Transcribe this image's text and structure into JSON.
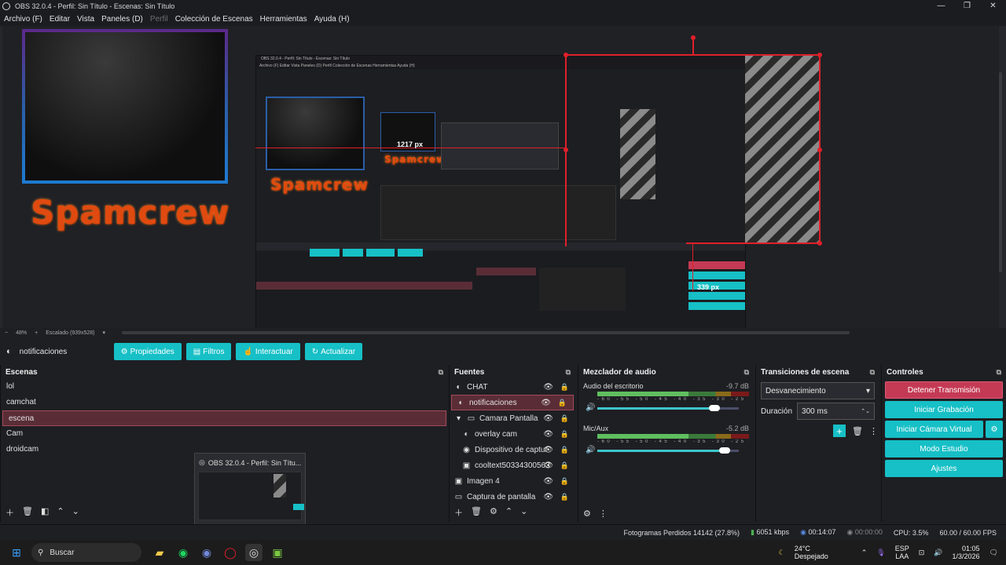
{
  "window": {
    "title": "OBS 32.0.4 - Perfil: Sin Título - Escenas: Sin Título",
    "min": "—",
    "max": "❐",
    "close": "✕"
  },
  "menu": [
    "Archivo (F)",
    "Editar",
    "Vista",
    "Paneles (D)",
    "Perfil",
    "Colección de Escenas",
    "Herramientas",
    "Ayuda (H)"
  ],
  "preview": {
    "spam_text": "Spamcrew",
    "measure_h": "1217 px",
    "measure_v": "339 px",
    "nested_title": "OBS 32.0.4 - Perfil: Sin Título - Escenas: Sin Título",
    "nested_menu": "Archivo (F)   Editar   Vista   Paneles (D)   Perfil   Colección de Escenas   Herramientas   Ayuda (H)",
    "zoom": "48%",
    "scaled": "Escalado (939x528)"
  },
  "source_bar": {
    "name": "notificaciones",
    "buttons": [
      "Propiedades",
      "Filtros",
      "Interactuar",
      "Actualizar"
    ]
  },
  "scenes": {
    "title": "Escenas",
    "items": [
      "lol",
      "camchat",
      "escena",
      "Cam",
      "droidcam"
    ],
    "selected": 2
  },
  "sources": {
    "title": "Fuentes",
    "items": [
      {
        "label": "CHAT",
        "icon": "◐",
        "indent": 0
      },
      {
        "label": "notificaciones",
        "icon": "◐",
        "indent": 0,
        "sel": true
      },
      {
        "label": "Camara Pantalla",
        "icon": "▭",
        "indent": 0,
        "group": true
      },
      {
        "label": "overlay cam",
        "icon": "◐",
        "indent": 1
      },
      {
        "label": "Dispositivo de captur",
        "icon": "◉",
        "indent": 1
      },
      {
        "label": "cooltext50334300563",
        "icon": "▣",
        "indent": 1
      },
      {
        "label": "Imagen 4",
        "icon": "▣",
        "indent": 0
      },
      {
        "label": "Captura de pantalla",
        "icon": "▭",
        "indent": 0
      }
    ]
  },
  "mixer": {
    "title": "Mezclador de audio",
    "channels": [
      {
        "name": "Audio del escritorio",
        "db": "-9.7 dB",
        "level": 0.83
      },
      {
        "name": "Mic/Aux",
        "db": "-5.2 dB",
        "level": 0.9
      }
    ],
    "scale": "-60 -55 -50 -45 -40 -35 -30 -25 -20 -15 -10 -5 0"
  },
  "transitions": {
    "title": "Transiciones de escena",
    "selected": "Desvanecimiento",
    "duration_label": "Duración",
    "duration": "300 ms"
  },
  "controls": {
    "title": "Controles",
    "buttons": [
      "Detener Transmisión",
      "Iniciar Grabación",
      "Iniciar Cámara Virtual",
      "Modo Estudio",
      "Ajustes"
    ]
  },
  "status": {
    "dropped": "Fotogramas Perdidos 14142 (27.8%)",
    "bitrate": "6051 kbps",
    "stream_time": "00:14:07",
    "rec_time": "00:00:00",
    "cpu": "CPU: 3.5%",
    "fps": "60.00 / 60.00 FPS"
  },
  "thumbnail": {
    "title": "OBS 32.0.4 - Perfil: Sin Títu..."
  },
  "taskbar": {
    "search": "Buscar",
    "weather_temp": "24°C",
    "weather_desc": "Despejado",
    "lang": "ESP",
    "lang2": "LAA",
    "time": "01:05",
    "date": "1/3/2026"
  },
  "colors": {
    "accent": "#16c0c6",
    "selected": "#5a2d36",
    "stop": "#c43a55"
  }
}
